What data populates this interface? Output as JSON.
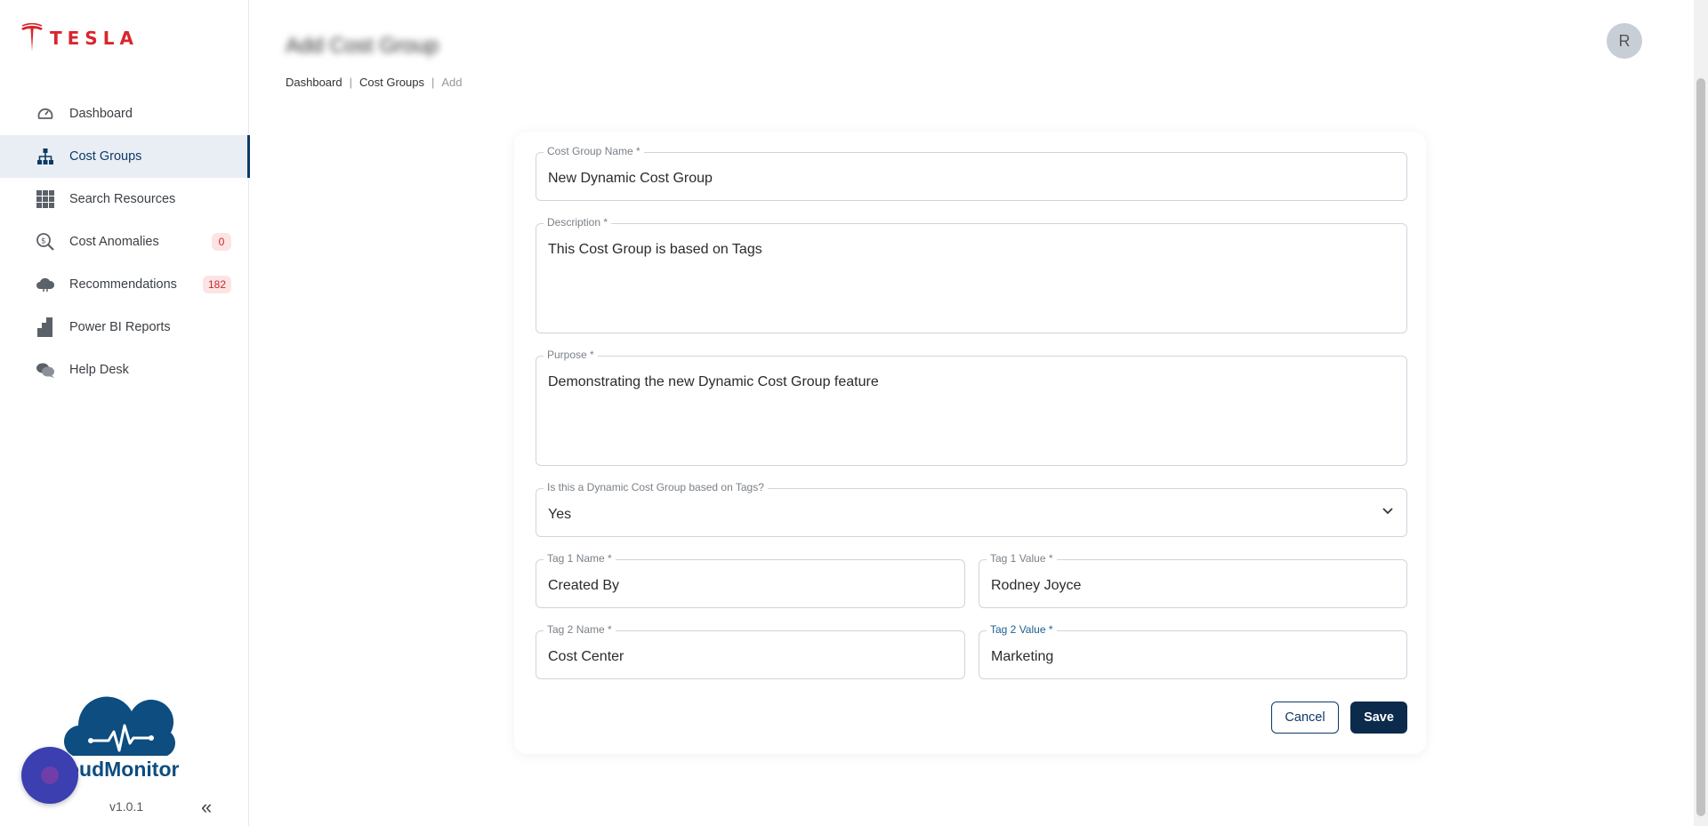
{
  "brand": {
    "name": "TESLA",
    "color": "#d8262e"
  },
  "sidebar": {
    "items": [
      {
        "label": "Dashboard",
        "icon": "dashboard-gauge-icon"
      },
      {
        "label": "Cost Groups",
        "icon": "hierarchy-icon",
        "active": true
      },
      {
        "label": "Search Resources",
        "icon": "grid-icon"
      },
      {
        "label": "Cost Anomalies",
        "icon": "magnify-dollar-icon",
        "badge": "0"
      },
      {
        "label": "Recommendations",
        "icon": "cloud-icon",
        "badge": "182"
      },
      {
        "label": "Power BI Reports",
        "icon": "bar-chart-icon"
      },
      {
        "label": "Help Desk",
        "icon": "chat-bubbles-icon"
      }
    ],
    "app_name": "oudMonitor",
    "version": "v1.0.1",
    "collapse_glyph": "«"
  },
  "header": {
    "title": "Add Cost Group",
    "avatar_initial": "R",
    "breadcrumb": [
      "Dashboard",
      "Cost Groups",
      "Add"
    ],
    "breadcrumb_sep": "|"
  },
  "form": {
    "name": {
      "label": "Cost Group Name *",
      "value": "New Dynamic Cost Group"
    },
    "description": {
      "label": "Description *",
      "value": "This Cost Group is based on Tags"
    },
    "purpose": {
      "label": "Purpose *",
      "value": "Demonstrating the new Dynamic Cost Group feature"
    },
    "dynamic": {
      "label": "Is this a Dynamic Cost Group based on Tags?",
      "value": "Yes"
    },
    "tag1_name": {
      "label": "Tag 1 Name *",
      "value": "Created By"
    },
    "tag1_value": {
      "label": "Tag 1 Value *",
      "value": "Rodney Joyce"
    },
    "tag2_name": {
      "label": "Tag 2 Name *",
      "value": "Cost Center"
    },
    "tag2_value": {
      "label": "Tag 2 Value *",
      "value": "Marketing"
    },
    "cancel_label": "Cancel",
    "save_label": "Save"
  }
}
